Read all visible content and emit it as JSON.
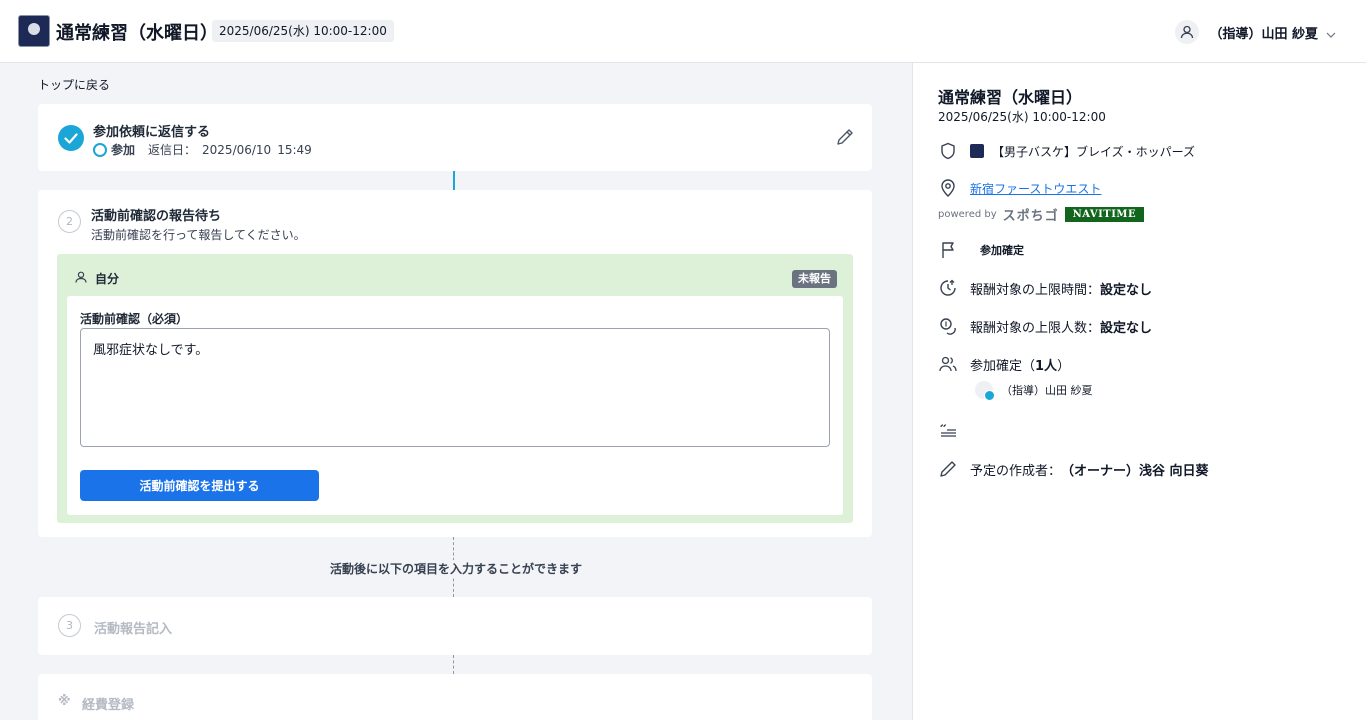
{
  "header": {
    "title": "通常練習（水曜日）",
    "date": "2025/06/25(水) 10:00-12:00",
    "user_name": "（指導）山田 紗夏"
  },
  "main": {
    "back_link": "トップに戻る",
    "step1": {
      "title": "参加依頼に返信する",
      "status": "参加",
      "reply_label": "返信日：",
      "reply_date": "2025/06/10",
      "reply_time": "15:49"
    },
    "step2": {
      "number": "2",
      "title": "活動前確認の報告待ち",
      "subtitle": "活動前確認を行って報告してください。",
      "self_label": "自分",
      "badge": "未報告",
      "field_label": "活動前確認（必須）",
      "field_value": "風邪症状なしです。",
      "submit_label": "活動前確認を提出する"
    },
    "after_note": "活動後に以下の項目を入力することができます",
    "step3": {
      "number": "3",
      "title": "活動報告記入"
    },
    "step4": {
      "marker": "※",
      "title": "経費登録"
    }
  },
  "side": {
    "title": "通常練習（水曜日）",
    "date": "2025/06/25(水) 10:00-12:00",
    "team": "【男子バスケ】ブレイズ・ホッパーズ",
    "venue": "新宿ファーストウエスト",
    "powered_by": "powered by",
    "spogo": "スポちゴ",
    "navitime": "NAVITIME",
    "status": "参加確定",
    "limit_time_label": "報酬対象の上限時間：",
    "limit_time_value": "設定なし",
    "limit_people_label": "報酬対象の上限人数：",
    "limit_people_value": "設定なし",
    "confirmed_label": "参加確定（",
    "confirmed_count": "1人",
    "confirmed_close": "）",
    "member_name": "（指導）山田 紗夏",
    "creator_label": "予定の作成者：",
    "creator_value": "（オーナー）浅谷 向日葵"
  },
  "colors": {
    "accent": "#1aa6d6",
    "primary_button": "#1a73e8",
    "green_box": "#ddf1d9",
    "navitime": "#11651d"
  }
}
